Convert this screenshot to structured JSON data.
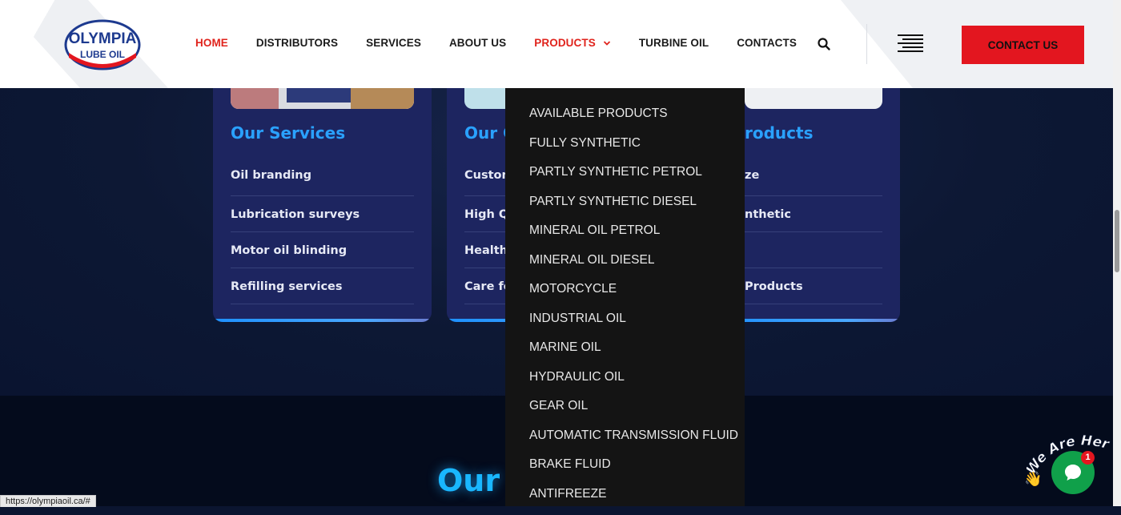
{
  "header": {
    "logo_text_top": "OLYMPIA",
    "logo_text_bottom": "LUBE OIL",
    "nav": [
      "HOME",
      "DISTRIBUTORS",
      "SERVICES",
      "ABOUT US",
      "PRODUCTS",
      "TURBINE OIL",
      "CONTACTS"
    ],
    "contact_button": "CONTACT US",
    "colors": {
      "accent_red": "#e3161f",
      "nav_active": "#e0231c"
    }
  },
  "cards": [
    {
      "title": "Our Services",
      "items": [
        "Oil branding",
        "Lubrication surveys",
        "Motor oil blinding",
        "Refilling services"
      ]
    },
    {
      "title": "Our C",
      "items": [
        "Custom",
        "High Qu",
        "Health &",
        "Care for"
      ]
    },
    {
      "title": "roducts",
      "items": [
        "ze",
        "nthetic",
        "",
        "Products"
      ]
    }
  ],
  "products_menu": {
    "items": [
      "AVAILABLE PRODUCTS",
      "FULLY SYNTHETIC",
      "PARTLY SYNTHETIC PETROL",
      "PARTLY SYNTHETIC DIESEL",
      "MINERAL OIL PETROL",
      "MINERAL OIL DIESEL",
      "MOTORCYCLE",
      "INDUSTRIAL OIL",
      "MARINE OIL",
      "HYDRAULIC OIL",
      "GEAR OIL",
      "AUTOMATIC TRANSMISSION FLUID",
      "BRAKE FLUID",
      "ANTIFREEZE"
    ]
  },
  "section_heading": "Our",
  "status_url": "https://olympiaoil.ca/#",
  "chat": {
    "tagline": "We Are Here!",
    "badge": "1"
  }
}
